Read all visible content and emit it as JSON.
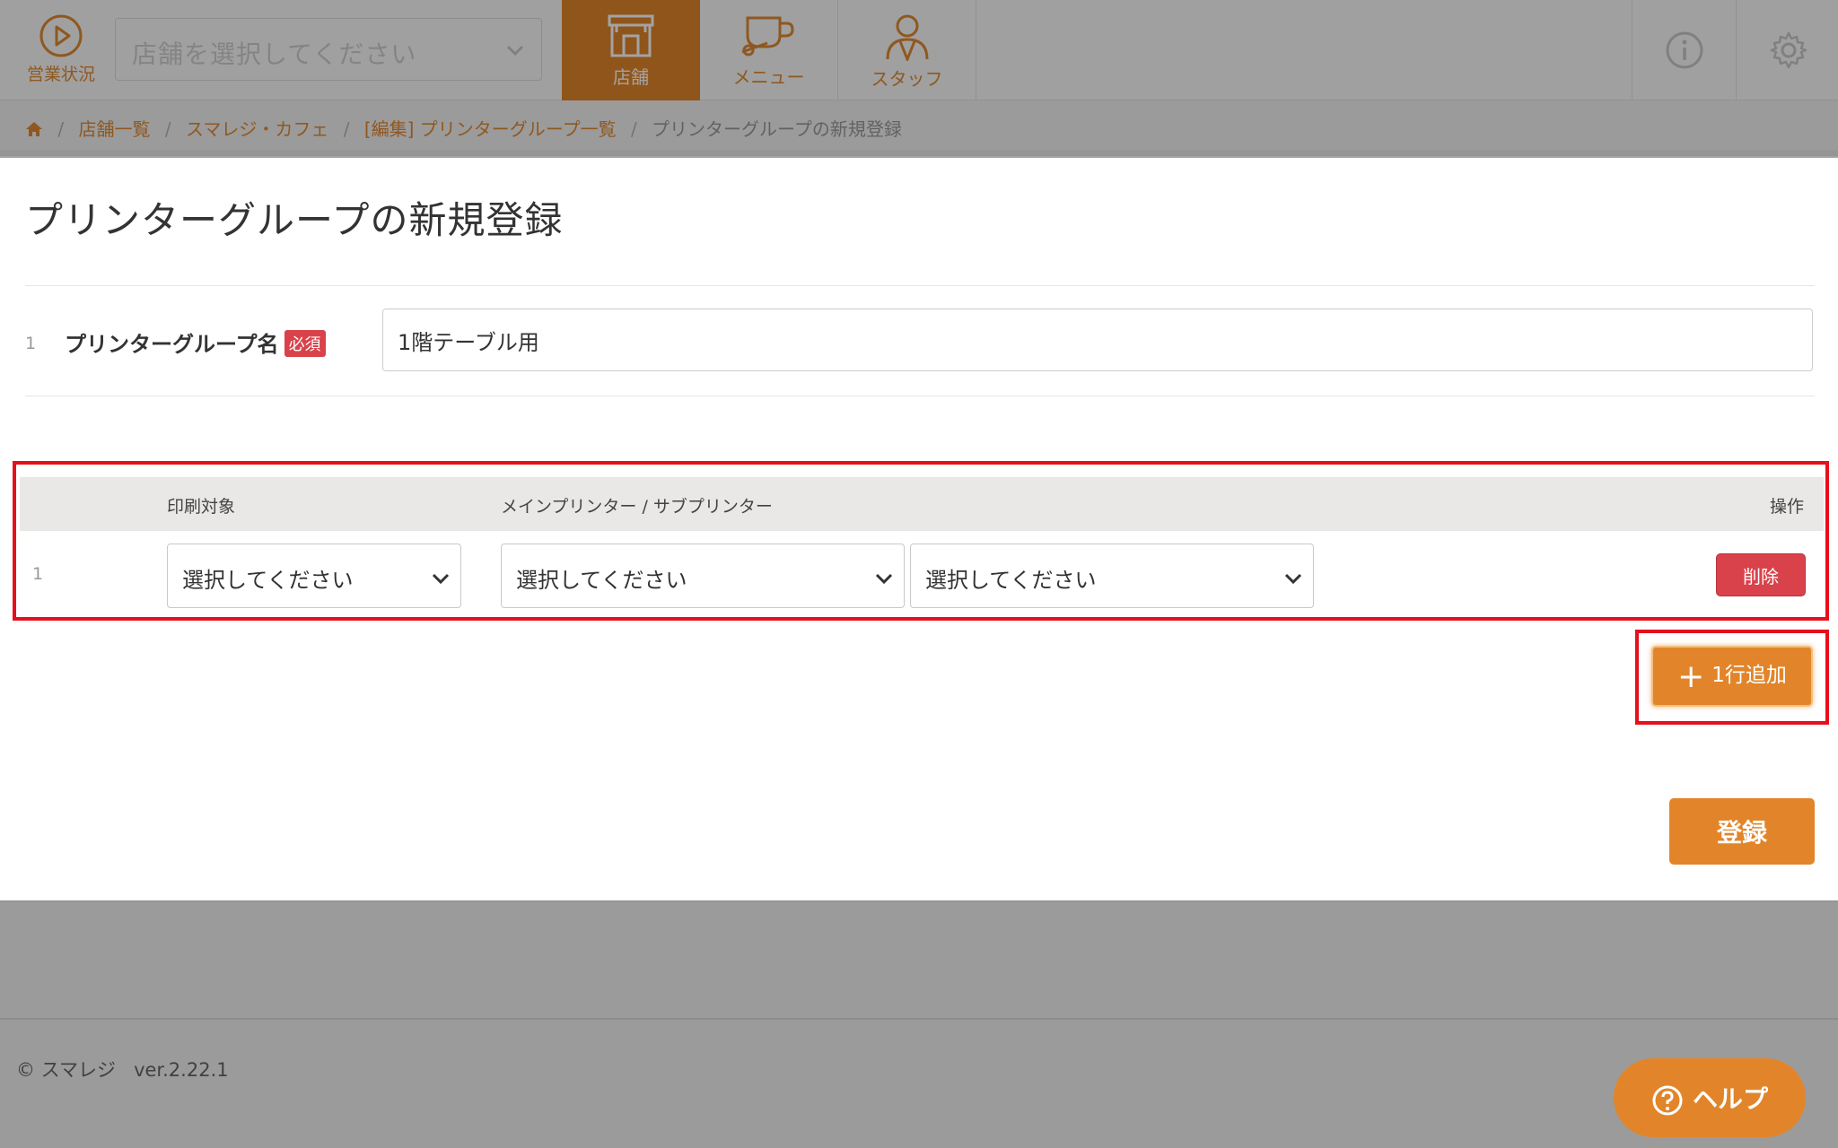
{
  "topbar": {
    "status_label": "営業状況",
    "store_select_placeholder": "店舗を選択してください",
    "tabs": [
      {
        "label": "店舗",
        "icon": "store-icon",
        "active": true
      },
      {
        "label": "メニュー",
        "icon": "cup-icon",
        "active": false
      },
      {
        "label": "スタッフ",
        "icon": "staff-icon",
        "active": false
      }
    ],
    "right_icons": [
      "info-icon",
      "gear-icon"
    ]
  },
  "breadcrumb": {
    "items": [
      "店舗一覧",
      "スマレジ・カフェ",
      "[編集] プリンターグループ一覧"
    ],
    "current": "プリンターグループの新規登録"
  },
  "page": {
    "title": "プリンターグループの新規登録"
  },
  "form": {
    "row_number": "1",
    "name_label": "プリンターグループ名",
    "required_badge": "必須",
    "name_value": "1階テーブル用"
  },
  "table": {
    "headers": {
      "target": "印刷対象",
      "printer": "メインプリンター / サブプリンター",
      "operation": "操作"
    },
    "rows": [
      {
        "number": "1",
        "target": "選択してください",
        "main_printer": "選択してください",
        "sub_printer": "選択してください",
        "delete_label": "削除"
      }
    ]
  },
  "buttons": {
    "add_row": "1行追加",
    "register": "登録"
  },
  "footer": {
    "copyright": "© スマレジ",
    "version": "ver.2.22.1",
    "help": "ヘルプ"
  },
  "colors": {
    "accent": "#e2852a",
    "danger": "#d9424a",
    "highlight": "#e6101c"
  }
}
